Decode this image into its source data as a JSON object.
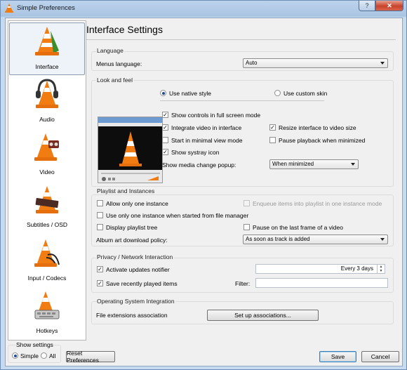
{
  "window": {
    "title": "Simple Preferences",
    "help_glyph": "?",
    "close_glyph": "✕"
  },
  "sidebar": {
    "items": [
      {
        "label": "Interface"
      },
      {
        "label": "Audio"
      },
      {
        "label": "Video"
      },
      {
        "label": "Subtitles / OSD"
      },
      {
        "label": "Input / Codecs"
      },
      {
        "label": "Hotkeys"
      }
    ]
  },
  "page": {
    "title": "Interface Settings"
  },
  "language": {
    "group_title": "Language",
    "menus_language_label": "Menus language:",
    "menus_language_value": "Auto"
  },
  "look": {
    "group_title": "Look and feel",
    "native_style": "Use native style",
    "custom_skin": "Use custom skin",
    "show_controls_fullscreen": "Show controls in full screen mode",
    "integrate_video": "Integrate video in interface",
    "resize_interface": "Resize interface to video size",
    "minimal_view": "Start in minimal view mode",
    "pause_minimized": "Pause playback when minimized",
    "show_systray": "Show systray icon",
    "media_change_popup_label": "Show media change popup:",
    "media_change_popup_value": "When minimized"
  },
  "playlist": {
    "group_title": "Playlist and Instances",
    "allow_one_instance": "Allow only one instance",
    "enqueue_one_instance": "Enqueue items into playlist in one instance mode",
    "one_instance_file_manager": "Use only one instance when started from file manager",
    "display_playlist_tree": "Display playlist tree",
    "pause_last_frame": "Pause on the last frame of a video",
    "album_art_label": "Album art download policy:",
    "album_art_value": "As soon as track is added"
  },
  "privacy": {
    "group_title": "Privacy / Network Interaction",
    "activate_updates": "Activate updates notifier",
    "update_interval": "Every 3 days",
    "save_recent": "Save recently played items",
    "filter_label": "Filter:",
    "filter_value": ""
  },
  "os": {
    "group_title": "Operating System Integration",
    "file_ext_label": "File extensions association",
    "setup_button": "Set up associations..."
  },
  "footer": {
    "show_settings_label": "Show settings",
    "simple_label": "Simple",
    "all_label": "All",
    "reset_button": "Reset Preferences",
    "save_button": "Save",
    "cancel_button": "Cancel"
  },
  "colors": {
    "cone_orange": "#f07c12",
    "accent_blue": "#1d4e9b",
    "window_frame": "#a9c4e3"
  }
}
